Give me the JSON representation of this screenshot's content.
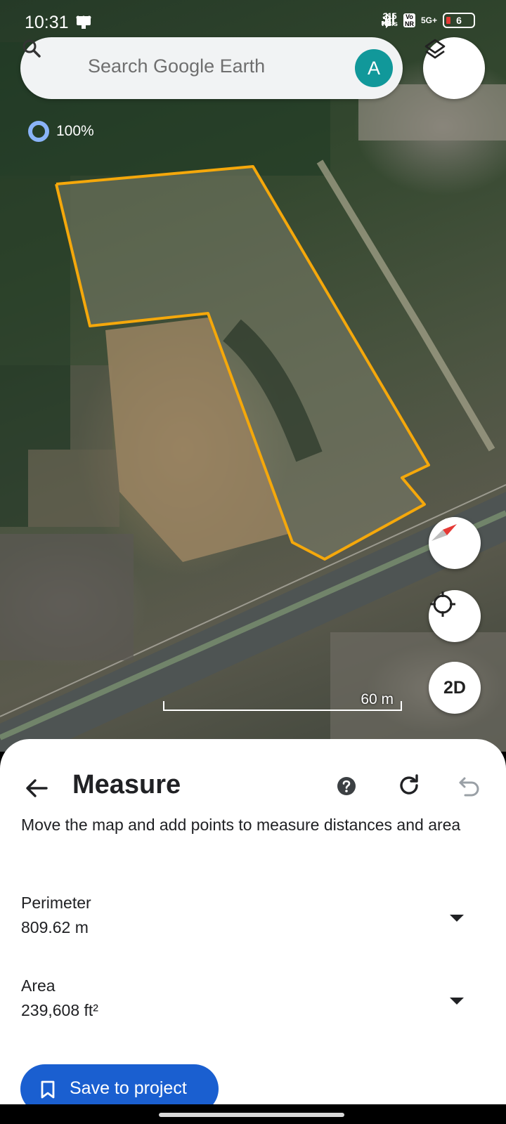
{
  "status_bar": {
    "time": "10:31",
    "net_speed_value": "215",
    "net_speed_unit": "KB/s",
    "network": "5G+",
    "vo_label": "Vo",
    "nr_label": "NR",
    "battery": "6",
    "icons": [
      "cast-icon",
      "more-icon",
      "bluetooth-icon",
      "volte-icon",
      "signal-icon",
      "battery-icon"
    ]
  },
  "search": {
    "placeholder": "Search Google Earth",
    "avatar_letter": "A",
    "avatar_color": "#11989a"
  },
  "map": {
    "layer_opacity": "100%",
    "scale_label": "60 m",
    "measure_outline_color": "#f5a80b",
    "view_mode_button": "2D",
    "icons": [
      "layers-icon",
      "compass-icon",
      "my-location-icon"
    ]
  },
  "measure_panel": {
    "title": "Measure",
    "instructions": "Move the map and add points to measure distances and area",
    "perimeter_label": "Perimeter",
    "perimeter_value": "809.62 m",
    "area_label": "Area",
    "area_value": "239,608 ft²",
    "save_button": "Save to project",
    "save_button_color": "#1a5fd0",
    "icons": [
      "back-arrow-icon",
      "help-icon",
      "refresh-icon",
      "undo-icon",
      "dropdown-icon",
      "bookmark-icon"
    ]
  }
}
